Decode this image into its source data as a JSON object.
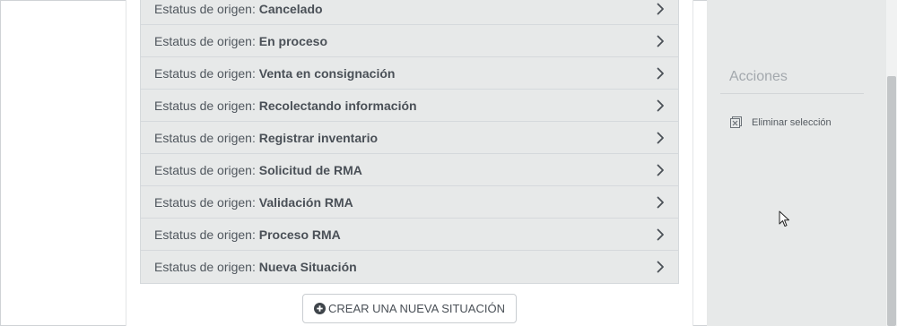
{
  "status_list": {
    "prefix": "Estatus de origen: ",
    "rows": [
      {
        "prefix": "Estatus de origen: ",
        "value": "Cancelado"
      },
      {
        "prefix": "Estatus de origen: ",
        "value": "En proceso"
      },
      {
        "prefix": "Estatus de origen: ",
        "value": "Venta en consignación"
      },
      {
        "prefix": "Estatus de origen: ",
        "value": "Recolectando información"
      },
      {
        "prefix": "Estatus de origen: ",
        "value": "Registrar inventario"
      },
      {
        "prefix": "Estatus de origen: ",
        "value": "Solicitud de RMA"
      },
      {
        "prefix": "Estatus de origen: ",
        "value": "Validación RMA"
      },
      {
        "prefix": "Estatus de origen: ",
        "value": "Proceso RMA"
      },
      {
        "prefix": "Estatus de origen: ",
        "value": "Nueva Situación"
      }
    ],
    "row_icon": "chevron-right-icon"
  },
  "create_button": {
    "label": "CREAR UNA NUEVA SITUACIÓN",
    "icon": "plus-circle-icon"
  },
  "sidebar": {
    "title": "Acciones",
    "actions": [
      {
        "label": "Eliminar selección",
        "icon": "delete-selection-icon"
      }
    ]
  },
  "colors": {
    "row_background": "#e7e9e9",
    "sidebar_background": "#e7e9e9",
    "text": "#4a5057"
  }
}
